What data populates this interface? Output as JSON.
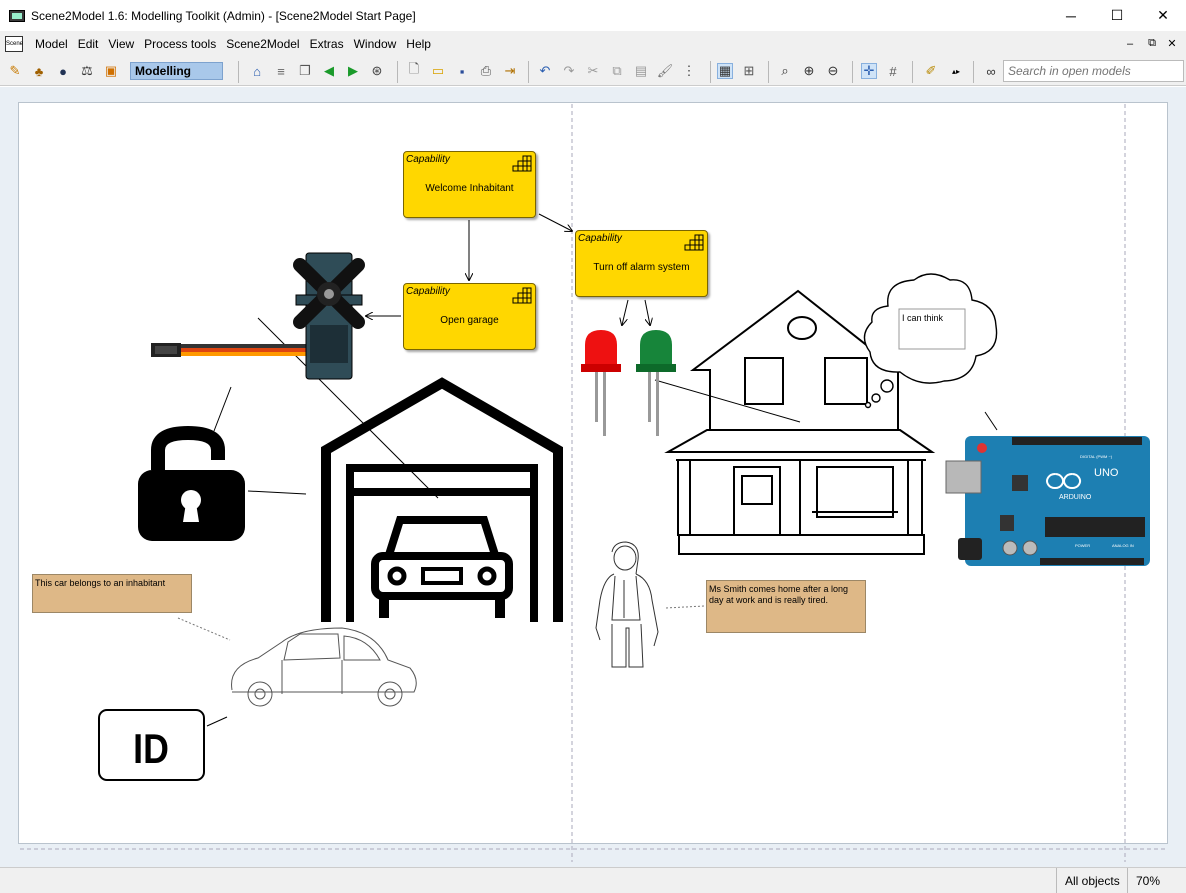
{
  "window": {
    "title": "Scene2Model 1.6: Modelling Toolkit (Admin) - [Scene2Model Start Page]",
    "controls": [
      "─",
      "☐",
      "✕"
    ]
  },
  "menu": {
    "items": [
      "Model",
      "Edit",
      "View",
      "Process tools",
      "Scene2Model",
      "Extras",
      "Window",
      "Help"
    ],
    "mdi_controls": [
      "–",
      "⧉",
      "✕"
    ],
    "mdi_icon_label": "Scene"
  },
  "toolbar": {
    "mode": "Modelling",
    "search_placeholder": "Search in open models"
  },
  "canvas": {
    "capabilities": [
      {
        "type": "Capability",
        "name": "Welcome Inhabitant"
      },
      {
        "type": "Capability",
        "name": "Turn off alarm system"
      },
      {
        "type": "Capability",
        "name": "Open garage"
      }
    ],
    "thought_text": "I can think",
    "id_label": "ID",
    "notes": [
      {
        "text": "This car belongs to an inhabitant"
      },
      {
        "text": "Ms Smith comes home after a long day at work and is really tired."
      }
    ],
    "arduino": {
      "brand": "ARDUINO",
      "model": "UNO",
      "label_digital": "DIGITAL (PWM ~)",
      "label_power": "POWER",
      "label_analog": "ANALOG IN"
    },
    "colors": {
      "capability": "#ffd700",
      "note": "#deb887",
      "led_red": "#ee1111",
      "led_green": "#17853a",
      "arduino": "#1d7fb2"
    }
  },
  "status": {
    "filter": "All objects",
    "zoom": "70%"
  }
}
